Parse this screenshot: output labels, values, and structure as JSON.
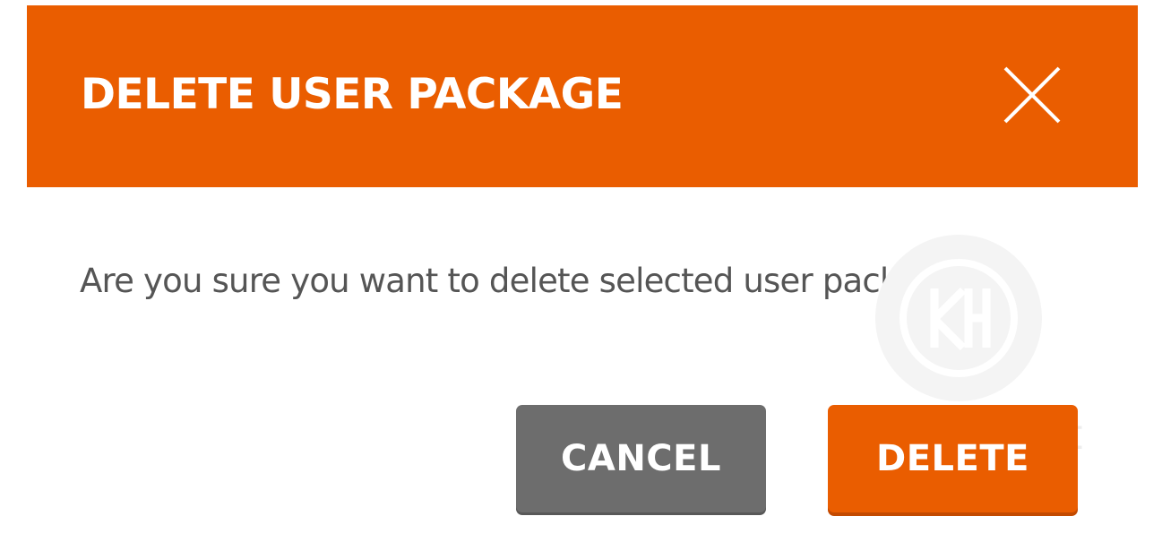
{
  "dialog": {
    "title": "DELETE USER PACKAGE",
    "close_icon": "close-icon",
    "message": "Are you sure you want to delete selected user package?",
    "cancel_label": "CANCEL",
    "delete_label": "DELETE"
  },
  "watermark": {
    "text": "KnownHost",
    "logo_icon": "knownhost-logo"
  },
  "colors": {
    "accent": "#ea5d00",
    "cancel": "#6d6d6d",
    "text": "#555555",
    "background": "#ffffff"
  }
}
